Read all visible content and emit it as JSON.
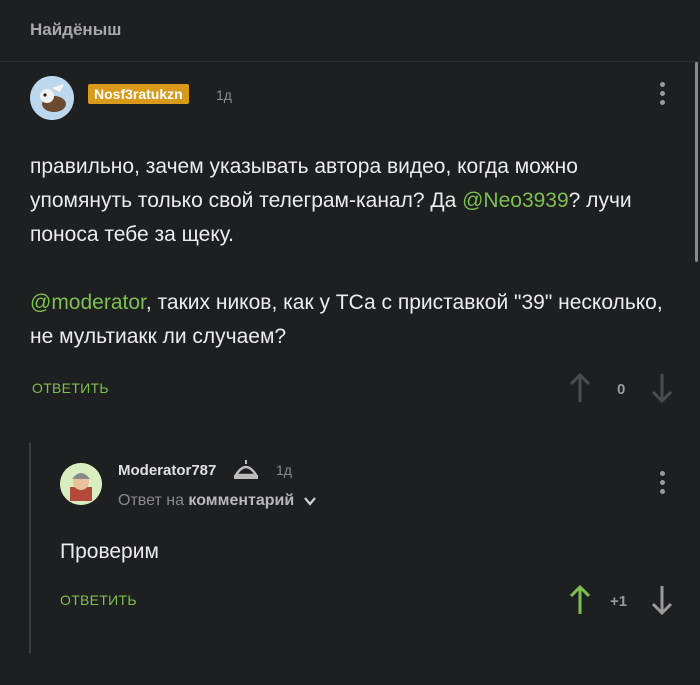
{
  "header": {
    "title": "Найдёныш"
  },
  "comment1": {
    "author": "Nosf3ratukzn",
    "time": "1д",
    "text": {
      "line1_pre": "правильно, зачем указывать автора видео, когда можно упомянуть только свой телеграм-канал? Да ",
      "mention1": "@Neo3939",
      "line1_post": "? лучи поноса тебе за щеку.",
      "mention2": "@moderator",
      "line2_post": ", таких ников, как у ТСа с приставкой \"39\" несколько, не мультиакк ли случаем?"
    },
    "reply_label": "ОТВЕТИТЬ",
    "votes": "0"
  },
  "comment2": {
    "author": "Moderator787",
    "time": "1д",
    "reply_to_prefix": "Ответ на ",
    "reply_to_target": "комментарий",
    "text": "Проверим",
    "reply_label": "ОТВЕТИТЬ",
    "votes": "+1"
  },
  "colors": {
    "accent_green": "#7fbf4d",
    "author_badge": "#d99a1b",
    "background": "#1d1f21"
  },
  "icons": {
    "menu": "kebab-menu-icon",
    "upvote": "arrow-up-icon",
    "downvote": "arrow-down-icon",
    "moderator": "moderator-helmet-icon",
    "expand": "chevron-down-icon"
  }
}
